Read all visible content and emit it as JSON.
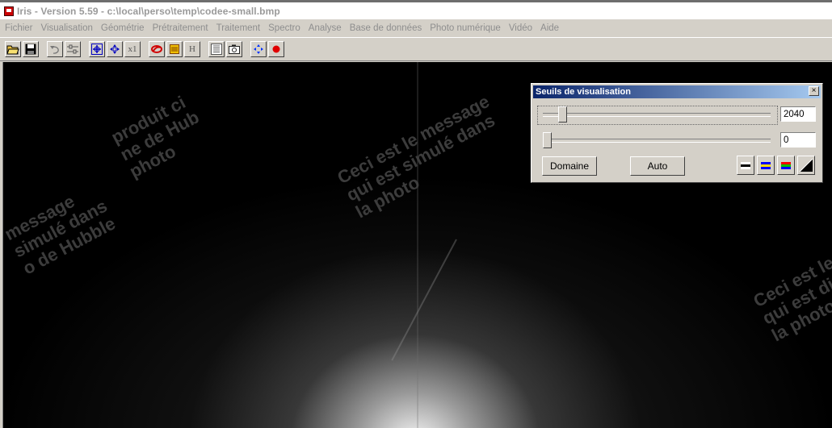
{
  "window": {
    "title": "Iris - Version 5.59 - c:\\local\\perso\\temp\\codee-small.bmp"
  },
  "menu": {
    "items": [
      "Fichier",
      "Visualisation",
      "Géométrie",
      "Prétraitement",
      "Traitement",
      "Spectro",
      "Analyse",
      "Base de données",
      "Photo numérique",
      "Vidéo",
      "Aide"
    ]
  },
  "toolbar": {
    "x1_label": "x1",
    "h_label": "H",
    "icons": [
      "open-folder-icon",
      "save-icon",
      "undo-icon",
      "settings-icon",
      "zoom-in-icon",
      "move-icon",
      "zoom-reset-icon",
      "red-swirl-icon",
      "palette-icon",
      "histogram-icon",
      "list-icon",
      "camera-icon",
      "blue-diamond-icon",
      "record-icon"
    ]
  },
  "dialog": {
    "title": "Seuils de visualisation",
    "close_label": "×",
    "high_threshold": "2040",
    "low_threshold": "0",
    "high_slider_fraction": 0.07,
    "low_slider_fraction": 0.0,
    "domain_button": "Domaine",
    "auto_button": "Auto"
  },
  "image": {
    "watermark_lines": {
      "top_left": [
        "produit ci",
        "ne de Hub",
        "photo"
      ],
      "center": [
        "Ceci est le message",
        "qui est simulé dans",
        "la photo"
      ],
      "left": [
        "message",
        "simulé dans",
        "o de Hubble"
      ],
      "right": [
        "Ceci est le",
        "qui est dis",
        "la photo"
      ]
    }
  },
  "colors": {
    "titlebar_text": "#9a9a9a",
    "dialog_title_gradient_start": "#0a246a",
    "dialog_title_gradient_end": "#a6caf0"
  }
}
